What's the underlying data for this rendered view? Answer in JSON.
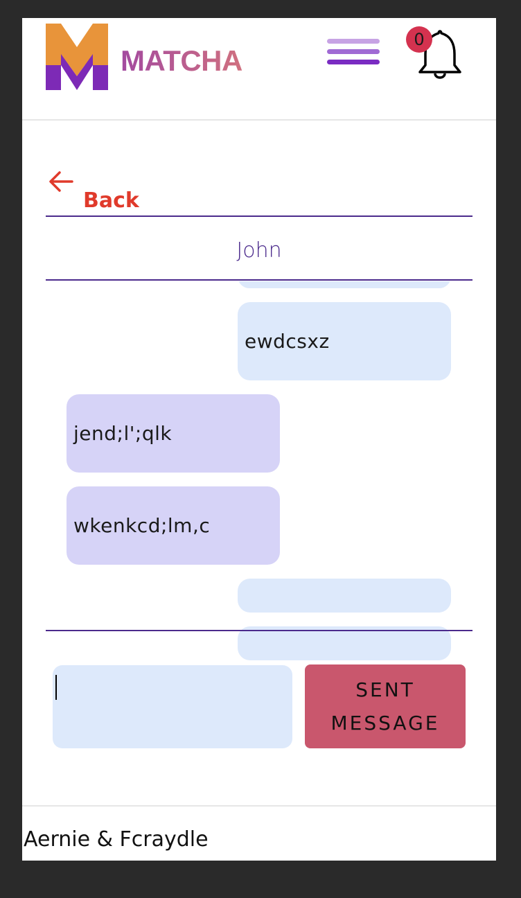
{
  "header": {
    "logo_text": "MATCHA",
    "notification_count": "0"
  },
  "nav": {
    "back_label": "Back"
  },
  "chat": {
    "contact_name": "John",
    "messages": [
      {
        "direction": "sent",
        "text": ""
      },
      {
        "direction": "sent",
        "text": "ewdcsxz"
      },
      {
        "direction": "received",
        "text": "jend;l';qlk"
      },
      {
        "direction": "received",
        "text": "wkenkcd;lm,c"
      },
      {
        "direction": "sent",
        "text": ""
      },
      {
        "direction": "sent",
        "text": ""
      }
    ]
  },
  "composer": {
    "input_value": "",
    "send_label": "SENT MESSAGE"
  },
  "footer": {
    "text": "Aernie & Fcraydle"
  },
  "colors": {
    "accent": "#4b2a8c",
    "back": "#e03a2b",
    "send_button": "#c9576d",
    "sent_bubble": "#dde9fb",
    "received_bubble": "#d6d3f7",
    "badge": "#d4324f"
  },
  "icons": {
    "menu": "hamburger-menu-icon",
    "notifications": "bell-icon",
    "back": "arrow-left-icon"
  }
}
